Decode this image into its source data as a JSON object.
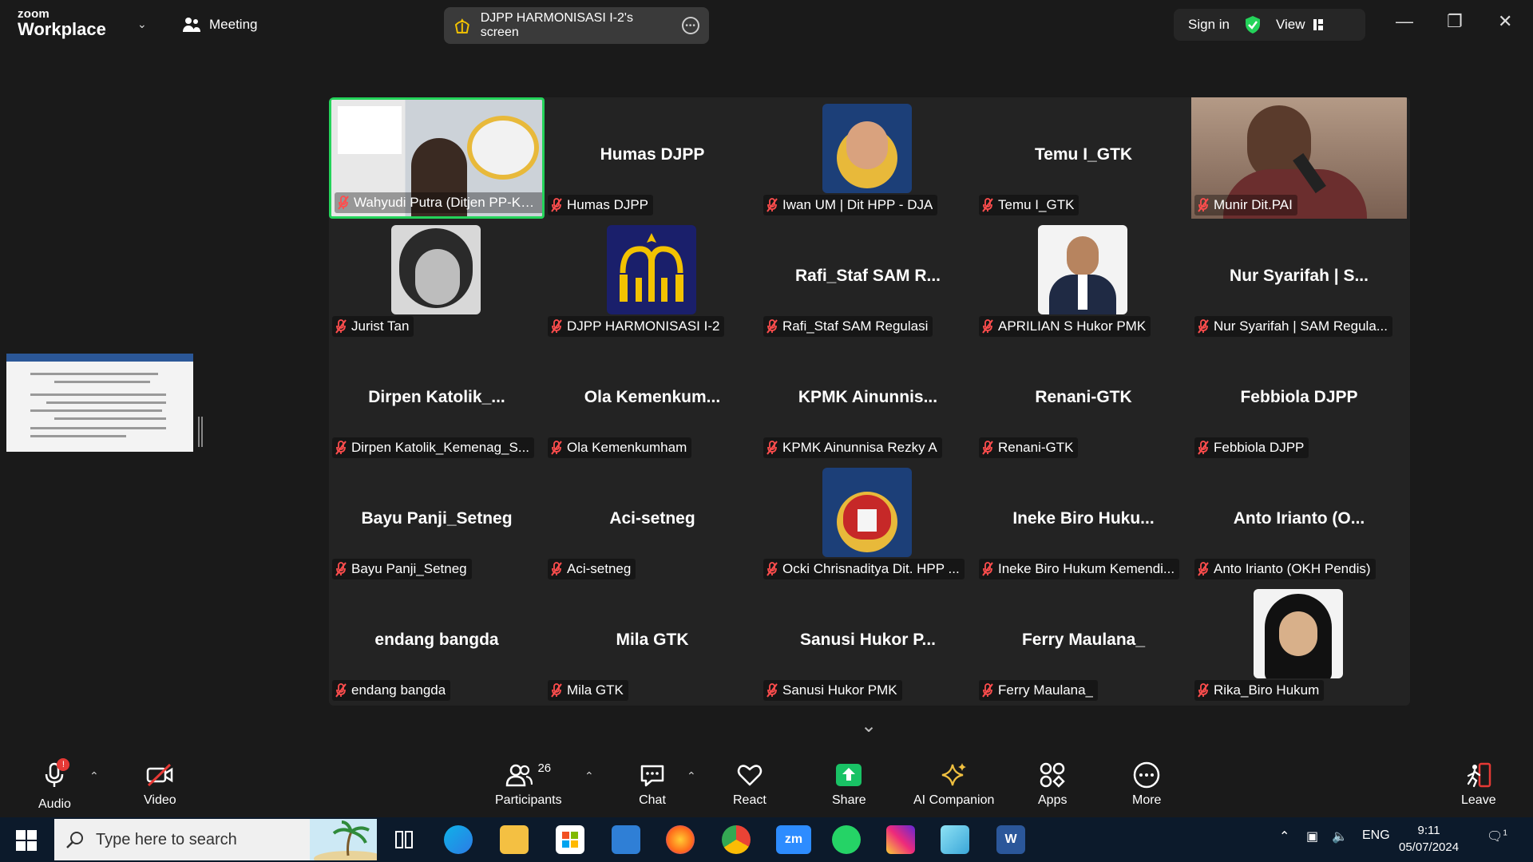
{
  "app": {
    "brand_small": "zoom",
    "brand_big": "Workplace",
    "meeting_label": "Meeting"
  },
  "screen_share": {
    "label": "DJPP HARMONISASI I-2's screen"
  },
  "header_right": {
    "sign_in": "Sign in",
    "view": "View"
  },
  "grid": {
    "tiles": [
      {
        "big": "",
        "label": "Wahyudi Putra (Ditjen PP-Kum...",
        "media": "video-presenter",
        "active": true
      },
      {
        "big": "Humas DJPP",
        "label": "Humas DJPP"
      },
      {
        "big": "",
        "label": "Iwan UM | Dit HPP - DJA",
        "media": "avatar-iwan"
      },
      {
        "big": "Temu I_GTK",
        "label": "Temu I_GTK"
      },
      {
        "big": "",
        "label": "Munir Dit.PAI",
        "media": "video-munir"
      },
      {
        "big": "",
        "label": "Jurist Tan",
        "media": "avatar-jurist"
      },
      {
        "big": "",
        "label": "DJPP HARMONISASI I-2",
        "media": "avatar-djpp"
      },
      {
        "big": "Rafi_Staf SAM R...",
        "label": "Rafi_Staf SAM Regulasi"
      },
      {
        "big": "",
        "label": "APRILIAN S Hukor PMK",
        "media": "avatar-aprilian"
      },
      {
        "big": "Nur Syarifah | S...",
        "label": "Nur Syarifah | SAM Regula..."
      },
      {
        "big": "Dirpen Katolik_...",
        "label": "Dirpen Katolik_Kemenag_S..."
      },
      {
        "big": "Ola Kemenkum...",
        "label": "Ola Kemenkumham"
      },
      {
        "big": "KPMK Ainunnis...",
        "label": "KPMK Ainunnisa Rezky A"
      },
      {
        "big": "Renani-GTK",
        "label": "Renani-GTK"
      },
      {
        "big": "Febbiola DJPP",
        "label": "Febbiola DJPP"
      },
      {
        "big": "Bayu Panji_Setneg",
        "label": "Bayu Panji_Setneg"
      },
      {
        "big": "Aci-setneg",
        "label": "Aci-setneg"
      },
      {
        "big": "",
        "label": "Ocki Chrisnaditya Dit. HPP ...",
        "media": "avatar-garuda"
      },
      {
        "big": "Ineke Biro Huku...",
        "label": "Ineke Biro Hukum Kemendi..."
      },
      {
        "big": "Anto Irianto (O...",
        "label": "Anto Irianto (OKH Pendis)"
      },
      {
        "big": "endang bangda",
        "label": "endang bangda"
      },
      {
        "big": "Mila GTK",
        "label": "Mila GTK"
      },
      {
        "big": "Sanusi Hukor P...",
        "label": "Sanusi Hukor PMK"
      },
      {
        "big": "Ferry Maulana_",
        "label": "Ferry Maulana_"
      },
      {
        "big": "",
        "label": "Rika_Biro Hukum",
        "media": "avatar-rika"
      }
    ]
  },
  "toolbar": {
    "audio": "Audio",
    "audio_badge": "!",
    "video": "Video",
    "participants": "Participants",
    "participants_count": "26",
    "chat": "Chat",
    "react": "React",
    "share": "Share",
    "ai": "AI Companion",
    "apps": "Apps",
    "more": "More",
    "leave": "Leave"
  },
  "taskbar": {
    "search_placeholder": "Type here to search",
    "zoom_label": "zm",
    "lang": "ENG",
    "time": "9:11",
    "date": "05/07/2024",
    "notif_count": "1"
  },
  "colors": {
    "accent_green": "#24d35a",
    "muted_red": "#e53935",
    "share_green": "#19c265",
    "taskbar": "#0c1a2b"
  }
}
